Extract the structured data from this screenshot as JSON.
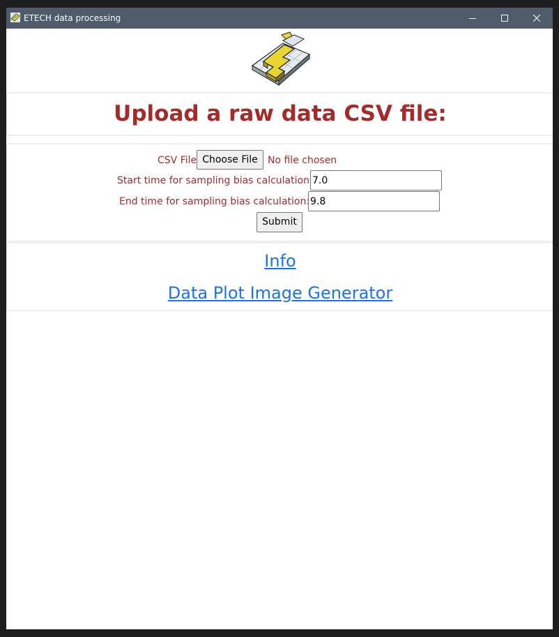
{
  "window": {
    "title": "ETECH data processing"
  },
  "page": {
    "heading": "Upload a raw data CSV file:"
  },
  "form": {
    "csv_label": "CSV File",
    "choose_file_label": "Choose File",
    "no_file_text": "No file chosen",
    "start_label": "Start time for sampling bias calculation:",
    "start_value": "7.0",
    "end_label": "End time for sampling bias calculation:",
    "end_value": "9.8",
    "submit_label": "Submit"
  },
  "links": {
    "info": "Info",
    "plot_generator": "Data Plot Image Generator"
  },
  "colors": {
    "titlebar": "#4e5b6a",
    "accent_text": "#a52a2a",
    "link": "#1a73e8"
  }
}
